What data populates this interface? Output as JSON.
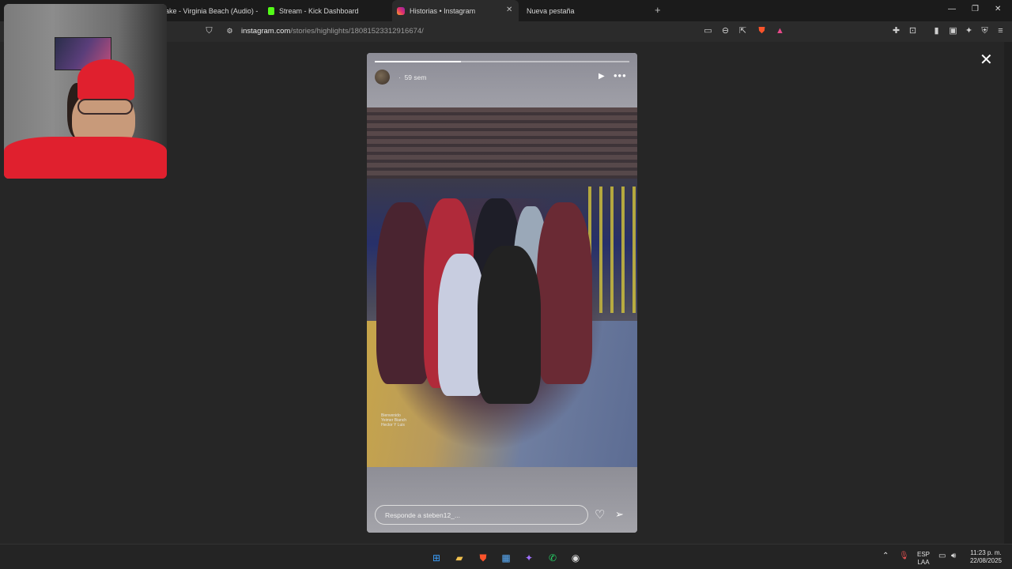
{
  "tabs": [
    {
      "label": "rake - Virginia Beach (Audio) -",
      "active": false
    },
    {
      "label": "Stream - Kick Dashboard",
      "active": false
    },
    {
      "label": "Historias • Instagram",
      "active": true
    },
    {
      "label": "Nueva pestaña",
      "active": false
    }
  ],
  "new_tab": "+",
  "url": {
    "host": "instagram.com",
    "path": "/stories/highlights/18081523312916674/"
  },
  "story": {
    "progress": 0.34,
    "time_ago": "59 sem",
    "dot": "·",
    "more": "•••",
    "reply_placeholder": "Responde a steben12_...",
    "watermark": "Bienvenido Yeimer Bianch Hector Y Luis"
  },
  "close": "✕",
  "taskbar": {
    "lang_top": "ESP",
    "lang_bottom": "LAA",
    "time": "11:23 p. m.",
    "date": "22/08/2025"
  },
  "colors": {
    "kick": "#53fc18",
    "instagram": "#e1306c",
    "brave": "#fb542b",
    "cap": "#e0202e"
  }
}
